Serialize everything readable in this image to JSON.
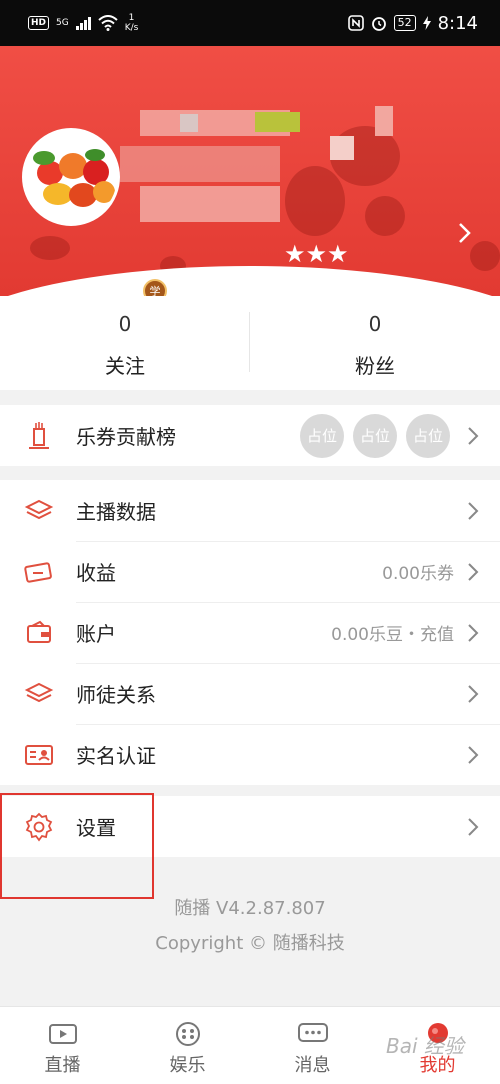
{
  "status_bar": {
    "hd": "HD",
    "net": "5G",
    "speed_value": "1",
    "speed_unit": "K/s",
    "battery": "52",
    "time": "8:14"
  },
  "profile": {
    "stars": "★★★",
    "badge": "学"
  },
  "stats": [
    {
      "value": "0",
      "label": "关注"
    },
    {
      "value": "0",
      "label": "粉丝"
    }
  ],
  "contribution": {
    "label": "乐券贡献榜",
    "seats": [
      "占位",
      "占位",
      "占位"
    ]
  },
  "menu": [
    {
      "label": "主播数据",
      "value": ""
    },
    {
      "label": "收益",
      "value": "0.00乐券"
    },
    {
      "label": "账户",
      "value": "0.00乐豆・充值"
    },
    {
      "label": "师徒关系",
      "value": ""
    },
    {
      "label": "实名认证",
      "value": ""
    }
  ],
  "settings": {
    "label": "设置"
  },
  "footer": {
    "version": "随播 V4.2.87.807",
    "copyright": "Copyright © 随播科技"
  },
  "tabs": [
    {
      "label": "直播",
      "icon": "tv-icon"
    },
    {
      "label": "娱乐",
      "icon": "dice-icon"
    },
    {
      "label": "消息",
      "icon": "chat-icon"
    },
    {
      "label": "我的",
      "icon": "profile-icon"
    }
  ],
  "watermark": "Bai 经验",
  "colors": {
    "accent": "#e23a32",
    "seat": "#d9d9d9",
    "highlight_box": "#e0362f"
  }
}
